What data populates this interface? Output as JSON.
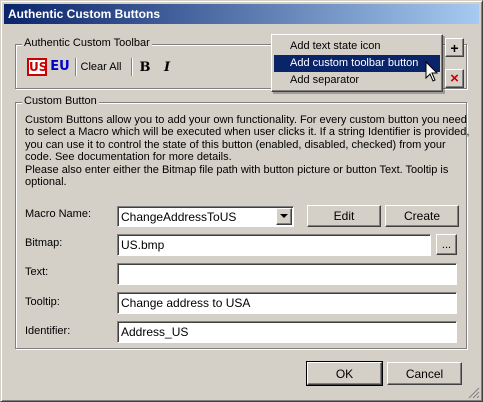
{
  "window": {
    "title": "Authentic Custom Buttons"
  },
  "toolbar_group": {
    "label": "Authentic Custom Toolbar",
    "icons": [
      {
        "name": "us-icon",
        "text": "US"
      },
      {
        "name": "eu-icon",
        "text": "EU"
      }
    ],
    "clear_all": "Clear All",
    "bold": "B",
    "italic": "I",
    "add_button": "+",
    "remove_button": "×"
  },
  "context_menu": {
    "items": [
      {
        "label": "Add text state icon",
        "selected": false
      },
      {
        "label": "Add custom toolbar button",
        "selected": true
      },
      {
        "label": "Add separator",
        "selected": false
      }
    ]
  },
  "custom_button_group": {
    "label": "Custom Button",
    "description": [
      "Custom Buttons allow you to add your own functionality. For every custom button you need",
      "to select a Macro which will be executed when user clicks it. If a string Identifier is provided,",
      "you can use it to control the state of this button (enabled, disabled, checked) from your",
      "code. See documentation for more details.",
      "Please also enter either the Bitmap file path with button picture or button Text. Tooltip is",
      "optional."
    ],
    "macro_label": "Macro Name:",
    "macro_value": "ChangeAddressToUS",
    "edit_button": "Edit",
    "create_button": "Create",
    "bitmap_label": "Bitmap:",
    "bitmap_value": "US.bmp",
    "browse_button": "...",
    "text_label": "Text:",
    "text_value": "",
    "tooltip_label": "Tooltip:",
    "tooltip_value": "Change address to USA",
    "identifier_label": "Identifier:",
    "identifier_value": "Address_US"
  },
  "footer": {
    "ok": "OK",
    "cancel": "Cancel"
  },
  "colors": {
    "titlebar_start": "#0a246a",
    "titlebar_end": "#a6caf0",
    "menu_selected": "#0a246a",
    "face": "#d4d0c8"
  }
}
